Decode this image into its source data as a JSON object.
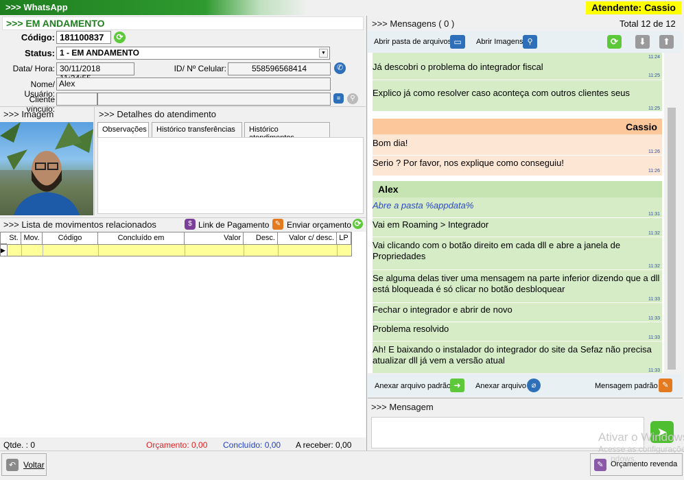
{
  "app": {
    "title": ">>> WhatsApp",
    "attendant": "Atendente: Cassio"
  },
  "ticket": {
    "status_header": ">>> EM ANDAMENTO",
    "code_label": "Código:",
    "code": "181100837",
    "status_label": "Status:",
    "status_value": "1 - EM ANDAMENTO",
    "datetime_label": "Data/ Hora:",
    "datetime": "30/11/2018 11:24:55",
    "phone_label": "ID/ Nº Celular:",
    "phone": "558596568414",
    "user_label": "Nome/ Usuário:",
    "user": "Alex",
    "client_label": "Cliente vínculo:",
    "client_code": "",
    "client_name": ""
  },
  "image_section": {
    "title": ">>> Imagem"
  },
  "details": {
    "title": ">>> Detalhes do atendimento",
    "tabs": [
      "Observações",
      "Histórico transferências",
      "Histórico atendimentos"
    ]
  },
  "movements": {
    "title": ">>> Lista de movimentos relacionados",
    "payment_link": "Link de Pagamento",
    "send_quote": "Enviar orçamento",
    "columns": [
      "St.",
      "Mov.",
      "Código",
      "Concluído em",
      "Valor",
      "Desc.",
      "Valor c/ desc.",
      "LP"
    ]
  },
  "totals": {
    "qty": "Qtde. : 0",
    "budget": "Orçamento: 0,00",
    "done": "Concluído: 0,00",
    "receivable": "A receber: 0,00"
  },
  "messages": {
    "header": ">>> Mensagens ( 0 )",
    "total": "Total 12 de 12",
    "open_folder": "Abrir pasta de arquivos",
    "open_images": "Abrir Imagens",
    "items": [
      {
        "text": "",
        "time": "11:24"
      },
      {
        "text": "Já descobri o problema do integrador fiscal",
        "time": "11:25"
      },
      {
        "text": "Explico já como resolver caso aconteça com outros clientes seus",
        "time": "11:25"
      },
      {
        "sender": "Cassio"
      },
      {
        "text": "Bom dia!",
        "time": "11:26"
      },
      {
        "text": "Serio ? Por favor, nos explique como conseguiu!",
        "time": "11:26"
      },
      {
        "sender": "Alex"
      },
      {
        "text": "Abre a pasta %appdata%",
        "time": "11:31"
      },
      {
        "text": "Vai em Roaming > Integrador",
        "time": "11:32"
      },
      {
        "text": "Vai clicando com o botão direito em cada dll e abre a janela de Propriedades",
        "time": "11:32"
      },
      {
        "text": "Se alguma delas tiver uma mensagem na parte inferior dizendo que a dll está bloqueada é só clicar no botão desbloquear",
        "time": "11:33"
      },
      {
        "text": "Fechar o integrador e abrir de novo",
        "time": "11:33"
      },
      {
        "text": "Problema resolvido",
        "time": "11:33"
      },
      {
        "text": "Ah! E baixando o instalador do integrador do site da Sefaz não precisa atualizar dll já vem a versão atual",
        "time": "11:33"
      }
    ],
    "attach_default": "Anexar arquivo padrão",
    "attach_file": "Anexar arquivo",
    "default_message": "Mensagem padrão"
  },
  "compose": {
    "title": ">>> Mensagem",
    "value": ""
  },
  "footer": {
    "back": "Voltar",
    "revenue_quote": "Orçamento revenda"
  },
  "watermark": {
    "line1": "Ativar o Windows",
    "line2": "Acesse as configurações",
    "line3": "ndows."
  },
  "colors": {
    "green_header": "#1f7f1f",
    "attendant_bg": "#ffff00",
    "msg_green": "#d6ecc6",
    "msg_orange": "#fde7d4",
    "sender_orange": "#fcc79a",
    "sender_green": "#c5e4b1",
    "grid_row": "#ffff99"
  }
}
